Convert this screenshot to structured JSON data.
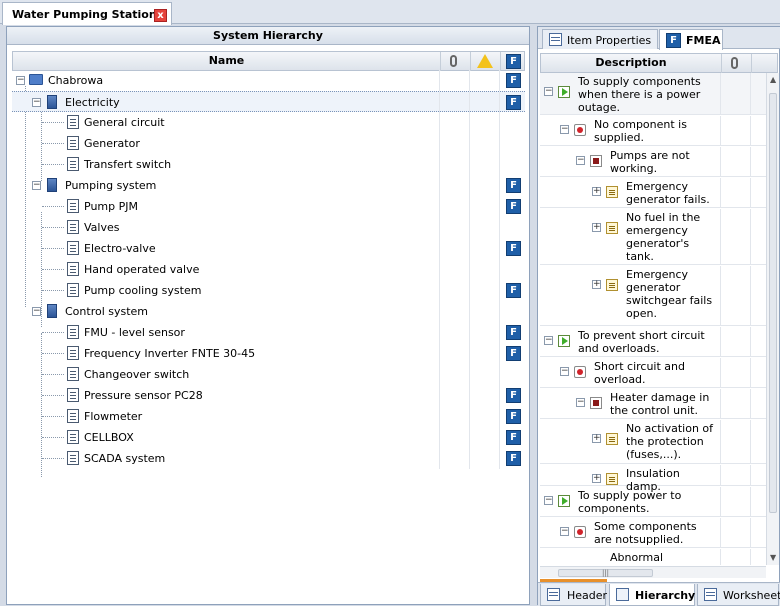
{
  "document_tab": {
    "title": "Water Pumping Station"
  },
  "left_panel": {
    "title": "System Hierarchy",
    "columns": {
      "name": "Name"
    },
    "tree": [
      {
        "label": "Chabrowa",
        "fmea": true
      },
      {
        "label": "Electricity",
        "fmea": true,
        "selected": true
      },
      {
        "label": "General circuit",
        "fmea": false
      },
      {
        "label": "Generator",
        "fmea": false
      },
      {
        "label": "Transfert switch",
        "fmea": false
      },
      {
        "label": "Pumping system",
        "fmea": true
      },
      {
        "label": "Pump PJM",
        "fmea": true
      },
      {
        "label": "Valves",
        "fmea": false
      },
      {
        "label": "Electro-valve",
        "fmea": true
      },
      {
        "label": "Hand operated valve",
        "fmea": false
      },
      {
        "label": "Pump cooling system",
        "fmea": true
      },
      {
        "label": "Control system",
        "fmea": false
      },
      {
        "label": "FMU - level sensor",
        "fmea": true
      },
      {
        "label": "Frequency Inverter FNTE 30-45",
        "fmea": true
      },
      {
        "label": "Changeover switch",
        "fmea": false
      },
      {
        "label": "Pressure sensor PC28",
        "fmea": true
      },
      {
        "label": "Flowmeter",
        "fmea": true
      },
      {
        "label": "CELLBOX",
        "fmea": true
      },
      {
        "label": "SCADA system",
        "fmea": true
      }
    ]
  },
  "right_panel": {
    "tabs": [
      {
        "label": "Item Properties"
      },
      {
        "label": "FMEA"
      }
    ],
    "columns": {
      "description": "Description"
    },
    "fmea_items": [
      {
        "text": "To supply components when there is a power outage."
      },
      {
        "text": "No component is supplied."
      },
      {
        "text": "Pumps are not working."
      },
      {
        "text": "Emergency generator fails."
      },
      {
        "text": "No fuel in the emergency generator's tank."
      },
      {
        "text": "Emergency generator switchgear fails open."
      },
      {
        "text": "To prevent short circuit and overloads."
      },
      {
        "text": "Short circuit and overload."
      },
      {
        "text": "Heater damage in the control unit."
      },
      {
        "text": "No activation of the protection (fuses,...)."
      },
      {
        "text": "Insulation damp."
      },
      {
        "text": "To supply power to components."
      },
      {
        "text": "Some components are notsupplied."
      },
      {
        "text": "Abnormal"
      }
    ],
    "bottom_tabs": [
      {
        "label": "Header"
      },
      {
        "label": "Hierarchy"
      },
      {
        "label": "Worksheet"
      }
    ]
  },
  "icons": {
    "fmea_glyph": "F",
    "close_glyph": "x",
    "scroll_thumb_grip": "|||",
    "scroll_up": "▲",
    "scroll_down": "▼"
  },
  "colors": {
    "accent": "#1f5fa8",
    "close": "#e5433c",
    "warning": "#f3c21b"
  }
}
